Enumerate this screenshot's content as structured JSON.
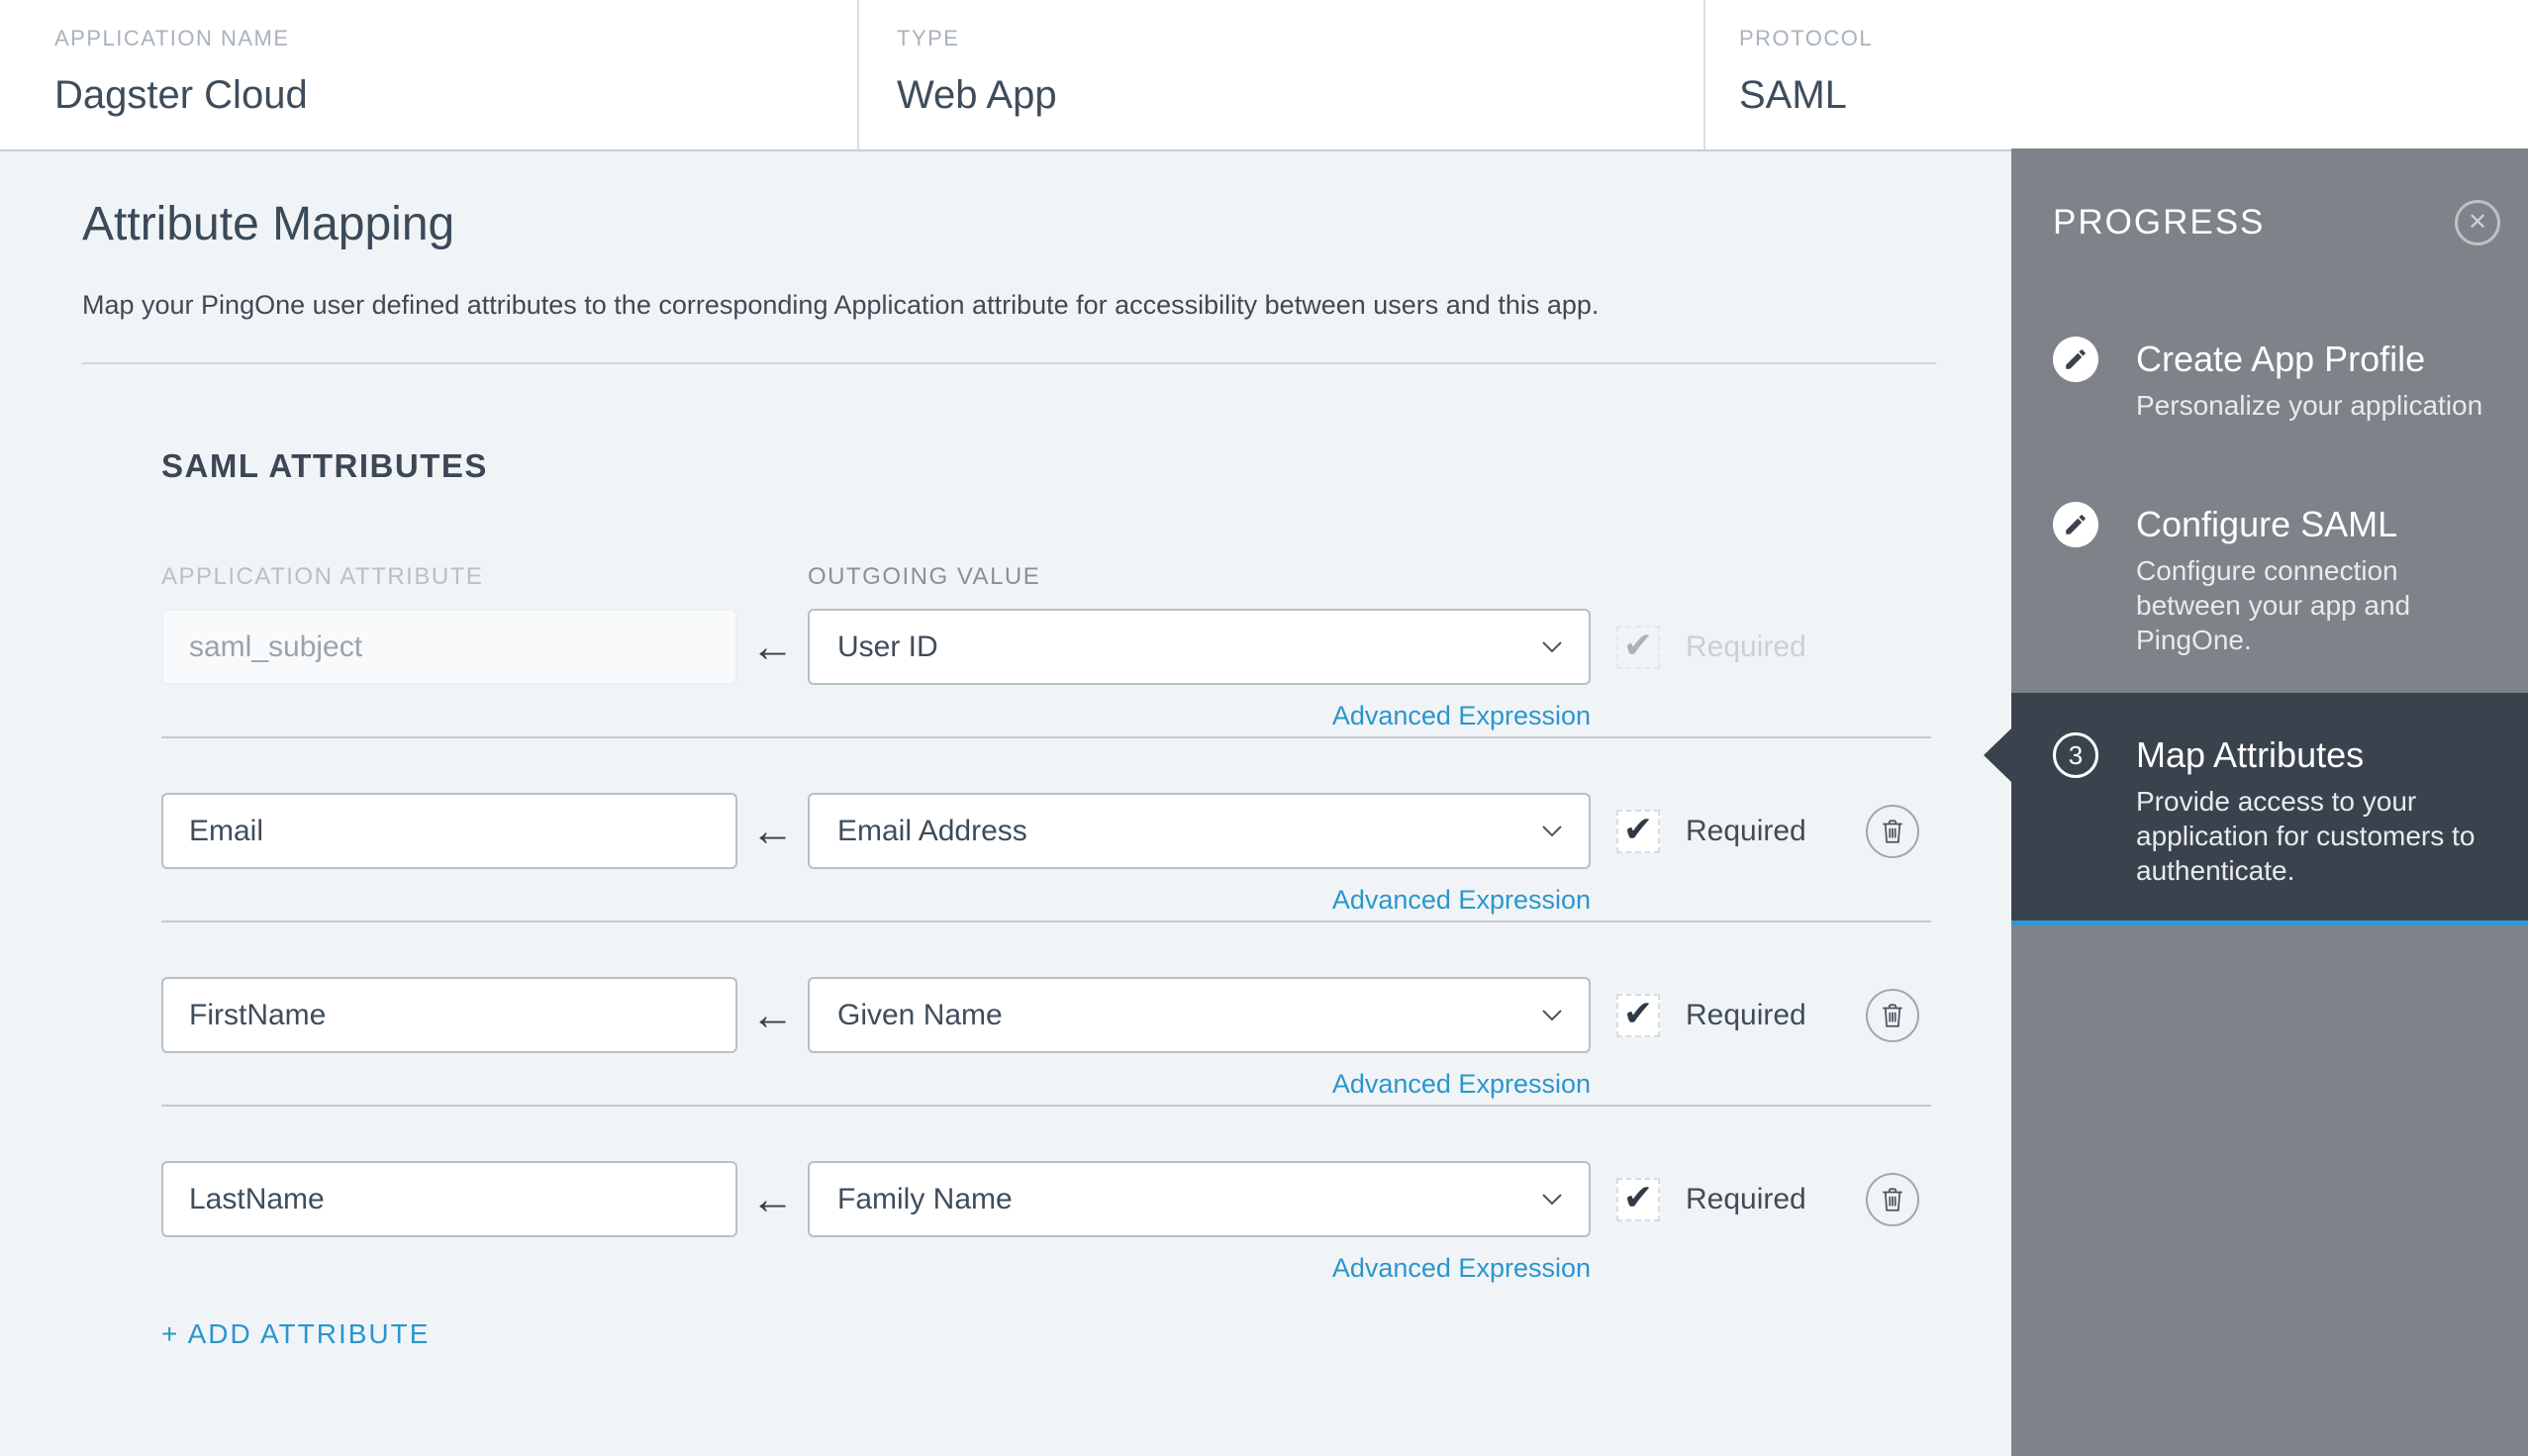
{
  "header": {
    "fields": [
      {
        "label": "APPLICATION NAME",
        "value": "Dagster Cloud"
      },
      {
        "label": "TYPE",
        "value": "Web App"
      },
      {
        "label": "PROTOCOL",
        "value": "SAML"
      }
    ]
  },
  "main": {
    "title": "Attribute Mapping",
    "description": "Map your PingOne user defined attributes to the corresponding Application attribute for accessibility between users and this app.",
    "section_title": "SAML ATTRIBUTES",
    "columns": {
      "application_attribute": "APPLICATION ATTRIBUTE",
      "outgoing_value": "OUTGOING VALUE"
    },
    "advanced_expression_label": "Advanced Expression",
    "required_label": "Required",
    "add_attribute_label": "+ ADD ATTRIBUTE",
    "rows": [
      {
        "application_attribute": "saml_subject",
        "outgoing_value": "User ID",
        "required": true,
        "disabled": true,
        "deletable": false
      },
      {
        "application_attribute": "Email",
        "outgoing_value": "Email Address",
        "required": true,
        "disabled": false,
        "deletable": true
      },
      {
        "application_attribute": "FirstName",
        "outgoing_value": "Given Name",
        "required": true,
        "disabled": false,
        "deletable": true
      },
      {
        "application_attribute": "LastName",
        "outgoing_value": "Family Name",
        "required": true,
        "disabled": false,
        "deletable": true
      }
    ]
  },
  "progress_panel": {
    "title": "PROGRESS",
    "steps": [
      {
        "icon": "pencil",
        "title": "Create App Profile",
        "description": "Personalize your application",
        "active": false
      },
      {
        "icon": "pencil",
        "title": "Configure SAML",
        "description": "Configure connection\nbetween your app and\nPingOne.",
        "active": false
      },
      {
        "icon": "number",
        "number": "3",
        "title": "Map Attributes",
        "description": "Provide access to your\napplication for customers to\nauthenticate.",
        "active": true
      }
    ]
  },
  "icons": {
    "close": "✕",
    "check": "✔",
    "arrow_left": "←",
    "chevron_down": "chevron-down",
    "pencil": "pencil",
    "trash": "trash-can"
  },
  "colors": {
    "page_background": "#f1f4f7",
    "header_background": "#ffffff",
    "link_blue": "#2b96cc",
    "accent_blue": "#2b9ad3",
    "panel_gray": "#7d8388",
    "panel_dark": "#3a434d",
    "text_dark": "#3d4d5c",
    "input_border": "#b6c0c8"
  }
}
